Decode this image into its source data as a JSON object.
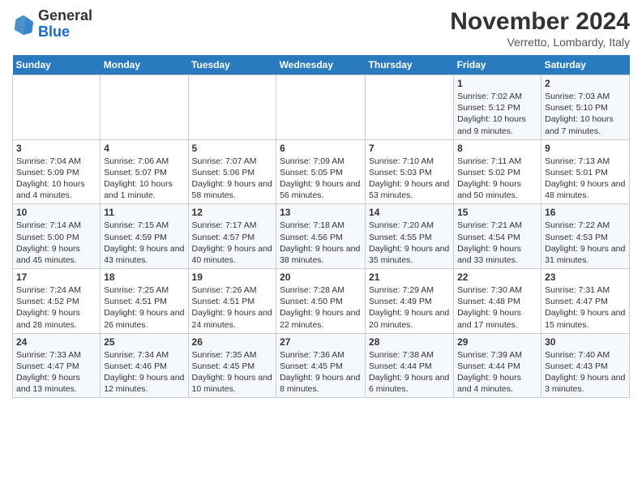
{
  "header": {
    "logo_general": "General",
    "logo_blue": "Blue",
    "month_title": "November 2024",
    "location": "Verretto, Lombardy, Italy"
  },
  "weekdays": [
    "Sunday",
    "Monday",
    "Tuesday",
    "Wednesday",
    "Thursday",
    "Friday",
    "Saturday"
  ],
  "weeks": [
    [
      {
        "day": "",
        "info": ""
      },
      {
        "day": "",
        "info": ""
      },
      {
        "day": "",
        "info": ""
      },
      {
        "day": "",
        "info": ""
      },
      {
        "day": "",
        "info": ""
      },
      {
        "day": "1",
        "info": "Sunrise: 7:02 AM\nSunset: 5:12 PM\nDaylight: 10 hours and 9 minutes."
      },
      {
        "day": "2",
        "info": "Sunrise: 7:03 AM\nSunset: 5:10 PM\nDaylight: 10 hours and 7 minutes."
      }
    ],
    [
      {
        "day": "3",
        "info": "Sunrise: 7:04 AM\nSunset: 5:09 PM\nDaylight: 10 hours and 4 minutes."
      },
      {
        "day": "4",
        "info": "Sunrise: 7:06 AM\nSunset: 5:07 PM\nDaylight: 10 hours and 1 minute."
      },
      {
        "day": "5",
        "info": "Sunrise: 7:07 AM\nSunset: 5:06 PM\nDaylight: 9 hours and 58 minutes."
      },
      {
        "day": "6",
        "info": "Sunrise: 7:09 AM\nSunset: 5:05 PM\nDaylight: 9 hours and 56 minutes."
      },
      {
        "day": "7",
        "info": "Sunrise: 7:10 AM\nSunset: 5:03 PM\nDaylight: 9 hours and 53 minutes."
      },
      {
        "day": "8",
        "info": "Sunrise: 7:11 AM\nSunset: 5:02 PM\nDaylight: 9 hours and 50 minutes."
      },
      {
        "day": "9",
        "info": "Sunrise: 7:13 AM\nSunset: 5:01 PM\nDaylight: 9 hours and 48 minutes."
      }
    ],
    [
      {
        "day": "10",
        "info": "Sunrise: 7:14 AM\nSunset: 5:00 PM\nDaylight: 9 hours and 45 minutes."
      },
      {
        "day": "11",
        "info": "Sunrise: 7:15 AM\nSunset: 4:59 PM\nDaylight: 9 hours and 43 minutes."
      },
      {
        "day": "12",
        "info": "Sunrise: 7:17 AM\nSunset: 4:57 PM\nDaylight: 9 hours and 40 minutes."
      },
      {
        "day": "13",
        "info": "Sunrise: 7:18 AM\nSunset: 4:56 PM\nDaylight: 9 hours and 38 minutes."
      },
      {
        "day": "14",
        "info": "Sunrise: 7:20 AM\nSunset: 4:55 PM\nDaylight: 9 hours and 35 minutes."
      },
      {
        "day": "15",
        "info": "Sunrise: 7:21 AM\nSunset: 4:54 PM\nDaylight: 9 hours and 33 minutes."
      },
      {
        "day": "16",
        "info": "Sunrise: 7:22 AM\nSunset: 4:53 PM\nDaylight: 9 hours and 31 minutes."
      }
    ],
    [
      {
        "day": "17",
        "info": "Sunrise: 7:24 AM\nSunset: 4:52 PM\nDaylight: 9 hours and 28 minutes."
      },
      {
        "day": "18",
        "info": "Sunrise: 7:25 AM\nSunset: 4:51 PM\nDaylight: 9 hours and 26 minutes."
      },
      {
        "day": "19",
        "info": "Sunrise: 7:26 AM\nSunset: 4:51 PM\nDaylight: 9 hours and 24 minutes."
      },
      {
        "day": "20",
        "info": "Sunrise: 7:28 AM\nSunset: 4:50 PM\nDaylight: 9 hours and 22 minutes."
      },
      {
        "day": "21",
        "info": "Sunrise: 7:29 AM\nSunset: 4:49 PM\nDaylight: 9 hours and 20 minutes."
      },
      {
        "day": "22",
        "info": "Sunrise: 7:30 AM\nSunset: 4:48 PM\nDaylight: 9 hours and 17 minutes."
      },
      {
        "day": "23",
        "info": "Sunrise: 7:31 AM\nSunset: 4:47 PM\nDaylight: 9 hours and 15 minutes."
      }
    ],
    [
      {
        "day": "24",
        "info": "Sunrise: 7:33 AM\nSunset: 4:47 PM\nDaylight: 9 hours and 13 minutes."
      },
      {
        "day": "25",
        "info": "Sunrise: 7:34 AM\nSunset: 4:46 PM\nDaylight: 9 hours and 12 minutes."
      },
      {
        "day": "26",
        "info": "Sunrise: 7:35 AM\nSunset: 4:45 PM\nDaylight: 9 hours and 10 minutes."
      },
      {
        "day": "27",
        "info": "Sunrise: 7:36 AM\nSunset: 4:45 PM\nDaylight: 9 hours and 8 minutes."
      },
      {
        "day": "28",
        "info": "Sunrise: 7:38 AM\nSunset: 4:44 PM\nDaylight: 9 hours and 6 minutes."
      },
      {
        "day": "29",
        "info": "Sunrise: 7:39 AM\nSunset: 4:44 PM\nDaylight: 9 hours and 4 minutes."
      },
      {
        "day": "30",
        "info": "Sunrise: 7:40 AM\nSunset: 4:43 PM\nDaylight: 9 hours and 3 minutes."
      }
    ]
  ]
}
